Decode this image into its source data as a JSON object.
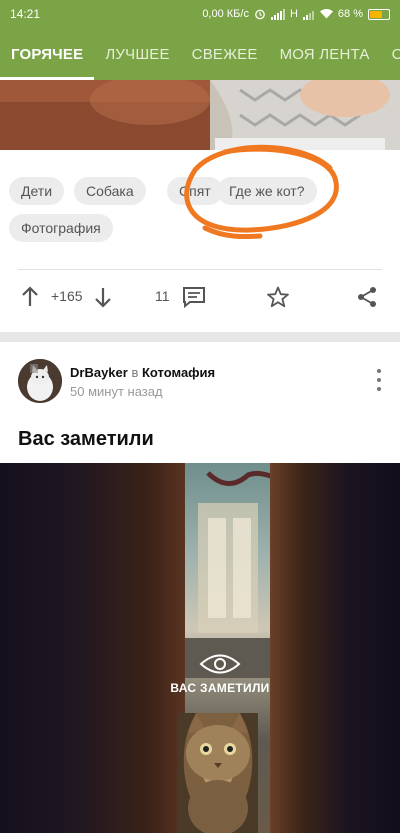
{
  "status_bar": {
    "time": "14:21",
    "network_speed": "0,00 КБ/с",
    "signal_label": "H",
    "battery_percent": "68 %",
    "battery_level": 0.68
  },
  "tabs": [
    {
      "label": "ГОРЯЧЕЕ",
      "active": true
    },
    {
      "label": "ЛУЧШЕЕ",
      "active": false
    },
    {
      "label": "СВЕЖЕЕ",
      "active": false
    },
    {
      "label": "МОЯ ЛЕНТА",
      "active": false
    },
    {
      "label": "СО",
      "active": false
    }
  ],
  "post1": {
    "tags": [
      "Дети",
      "Собака",
      "Спят",
      "Где же кот?",
      "Фотография"
    ],
    "rating": "+165",
    "comments_count": "11",
    "annotation_color": "#f07820"
  },
  "post2": {
    "author": "DrBayker",
    "in_word": "в",
    "community": "Котомафия",
    "time_ago": "50 минут назад",
    "title": "Вас заметили",
    "image_watermark": "ВАС ЗАМЕТИЛИ"
  },
  "colors": {
    "brand_green": "#7aa446",
    "icon_gray": "#555555"
  }
}
